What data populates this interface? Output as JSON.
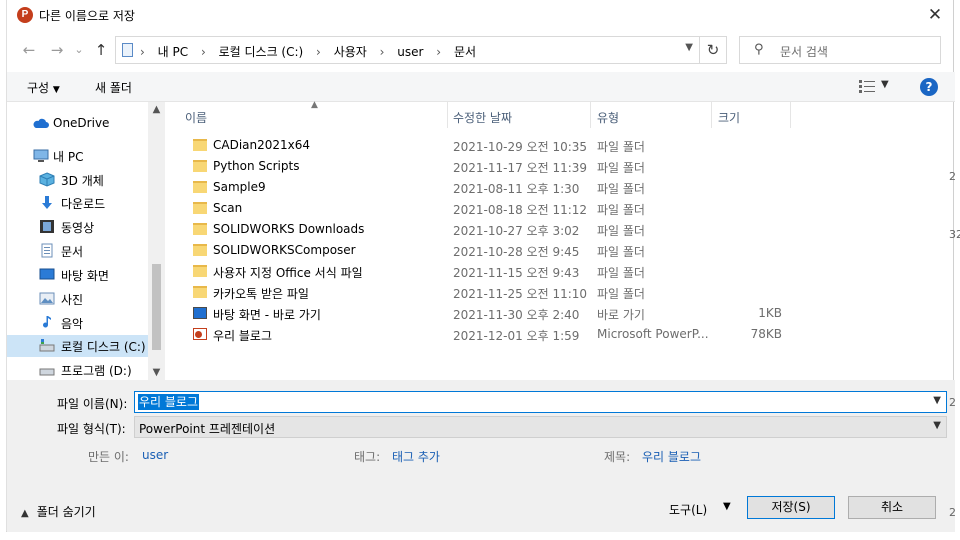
{
  "window": {
    "title": "다른 이름으로 저장",
    "app_icon": "P",
    "close_glyph": "✕"
  },
  "nav": {
    "back_glyph": "←",
    "forward_glyph": "→",
    "recent_glyph": "⌄",
    "up_glyph": "↑",
    "breadcrumbs": [
      "내 PC",
      "로컬 디스크 (C:)",
      "사용자",
      "user",
      "문서"
    ],
    "breadcrumb_sep": "›",
    "refresh_glyph": "↻",
    "search_placeholder": "문서 검색"
  },
  "toolbar": {
    "organize_label": "구성",
    "new_folder_label": "새 폴더",
    "help_label": "?"
  },
  "sidebar": {
    "items": [
      {
        "label": "OneDrive",
        "icon": "cloud-icon"
      },
      {
        "label": "내 PC",
        "icon": "pc-icon"
      },
      {
        "label": "3D 개체",
        "icon": "cube-icon"
      },
      {
        "label": "다운로드",
        "icon": "download-icon"
      },
      {
        "label": "동영상",
        "icon": "video-icon"
      },
      {
        "label": "문서",
        "icon": "document-icon"
      },
      {
        "label": "바탕 화면",
        "icon": "desktop-icon"
      },
      {
        "label": "사진",
        "icon": "picture-icon"
      },
      {
        "label": "음악",
        "icon": "music-icon"
      },
      {
        "label": "로컬 디스크 (C:)",
        "icon": "drive-icon"
      },
      {
        "label": "프로그램 (D:)",
        "icon": "drive-icon"
      }
    ]
  },
  "columns": {
    "name": "이름",
    "modified": "수정한 날짜",
    "type": "유형",
    "size": "크기"
  },
  "files": [
    {
      "name": "CADian2021x64",
      "modified": "2021-10-29 오전 10:35",
      "type": "파일 폴더",
      "size": "",
      "icon": "folder-icon"
    },
    {
      "name": "Python Scripts",
      "modified": "2021-11-17 오전 11:39",
      "type": "파일 폴더",
      "size": "",
      "icon": "folder-icon"
    },
    {
      "name": "Sample9",
      "modified": "2021-08-11 오후 1:30",
      "type": "파일 폴더",
      "size": "",
      "icon": "folder-icon"
    },
    {
      "name": "Scan",
      "modified": "2021-08-18 오전 11:12",
      "type": "파일 폴더",
      "size": "",
      "icon": "folder-icon"
    },
    {
      "name": "SOLIDWORKS Downloads",
      "modified": "2021-10-27 오후 3:02",
      "type": "파일 폴더",
      "size": "",
      "icon": "folder-icon"
    },
    {
      "name": "SOLIDWORKSComposer",
      "modified": "2021-10-28 오전 9:45",
      "type": "파일 폴더",
      "size": "",
      "icon": "folder-icon"
    },
    {
      "name": "사용자 지정 Office 서식 파일",
      "modified": "2021-11-15 오전 9:43",
      "type": "파일 폴더",
      "size": "",
      "icon": "folder-icon"
    },
    {
      "name": "카카오톡 받은 파일",
      "modified": "2021-11-25 오전 11:10",
      "type": "파일 폴더",
      "size": "",
      "icon": "folder-icon"
    },
    {
      "name": "바탕 화면 - 바로 가기",
      "modified": "2021-11-30 오후 2:40",
      "type": "바로 가기",
      "size": "1KB",
      "icon": "shortcut-icon"
    },
    {
      "name": "우리 블로그",
      "modified": "2021-12-01 오후 1:59",
      "type": "Microsoft PowerP...",
      "size": "78KB",
      "icon": "powerpoint-file-icon"
    }
  ],
  "form": {
    "filename_label": "파일 이름(N):",
    "filename_value": "우리 블로그",
    "filetype_label": "파일 형식(T):",
    "filetype_value": "PowerPoint 프레젠테이션",
    "author_label": "만든 이:",
    "author_value": "user",
    "tags_label": "태그:",
    "tags_value": "태그 추가",
    "subject_label": "제목:",
    "subject_value": "우리 블로그"
  },
  "footer": {
    "hide_folders_label": "폴더 숨기기",
    "tools_label": "도구(L)",
    "save_label": "저장(S)",
    "cancel_label": "취소"
  },
  "background_fragments": [
    "2",
    "32",
    "2",
    "2"
  ]
}
